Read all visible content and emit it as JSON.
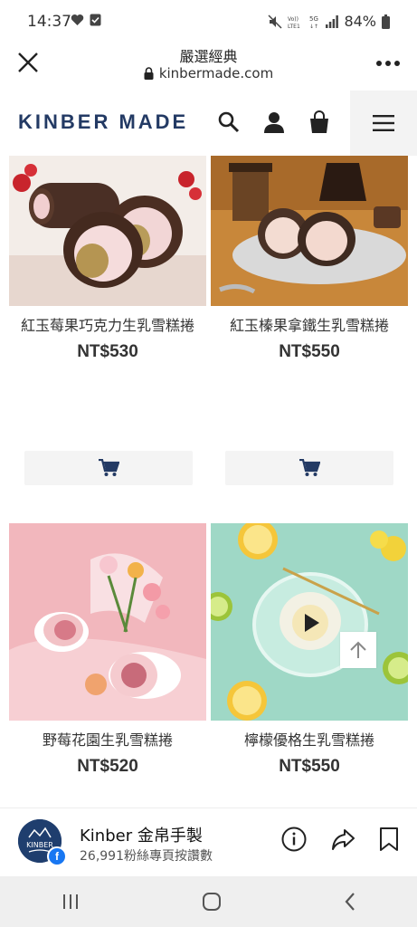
{
  "status_bar": {
    "time": "14:37",
    "battery": "84%"
  },
  "browser": {
    "title": "嚴選經典",
    "url": "kinbermade.com"
  },
  "site": {
    "logo": "KINBER MADE"
  },
  "products": [
    {
      "name": "紅玉莓果巧克力生乳雪糕捲",
      "price": "NT$530"
    },
    {
      "name": "紅玉榛果拿鐵生乳雪糕捲",
      "price": "NT$550"
    },
    {
      "name": "野莓花園生乳雪糕捲",
      "price": "NT$520"
    },
    {
      "name": "檸檬優格生乳雪糕捲",
      "price": "NT$550"
    }
  ],
  "fb_banner": {
    "name": "Kinber 金帛手製",
    "followers": "26,991粉絲專頁按讚數",
    "avatar_text": "KINBER"
  },
  "colors": {
    "brand": "#233a64",
    "cart_icon": "#233a64",
    "fb_blue": "#1877f2"
  }
}
